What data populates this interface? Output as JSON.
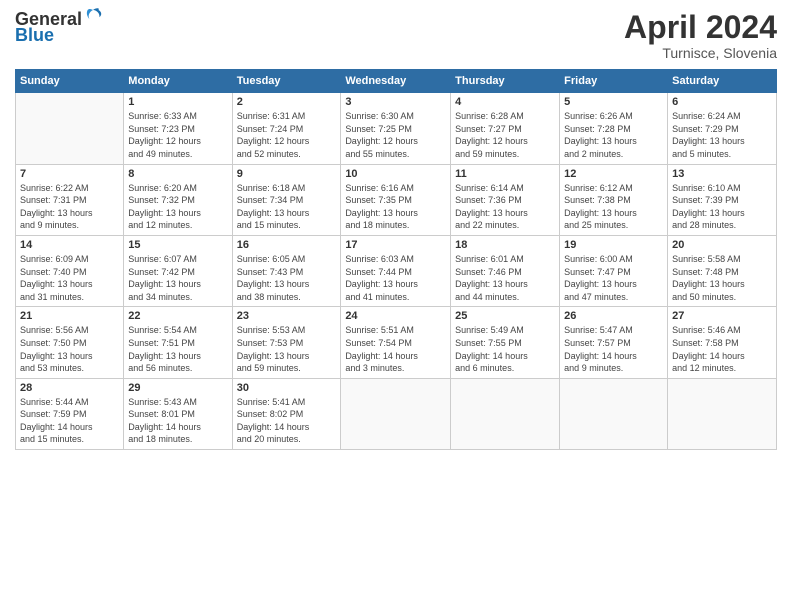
{
  "logo": {
    "text_general": "General",
    "text_blue": "Blue"
  },
  "title": "April 2024",
  "subtitle": "Turnisce, Slovenia",
  "header_days": [
    "Sunday",
    "Monday",
    "Tuesday",
    "Wednesday",
    "Thursday",
    "Friday",
    "Saturday"
  ],
  "weeks": [
    [
      {
        "day": "",
        "info": ""
      },
      {
        "day": "1",
        "info": "Sunrise: 6:33 AM\nSunset: 7:23 PM\nDaylight: 12 hours\nand 49 minutes."
      },
      {
        "day": "2",
        "info": "Sunrise: 6:31 AM\nSunset: 7:24 PM\nDaylight: 12 hours\nand 52 minutes."
      },
      {
        "day": "3",
        "info": "Sunrise: 6:30 AM\nSunset: 7:25 PM\nDaylight: 12 hours\nand 55 minutes."
      },
      {
        "day": "4",
        "info": "Sunrise: 6:28 AM\nSunset: 7:27 PM\nDaylight: 12 hours\nand 59 minutes."
      },
      {
        "day": "5",
        "info": "Sunrise: 6:26 AM\nSunset: 7:28 PM\nDaylight: 13 hours\nand 2 minutes."
      },
      {
        "day": "6",
        "info": "Sunrise: 6:24 AM\nSunset: 7:29 PM\nDaylight: 13 hours\nand 5 minutes."
      }
    ],
    [
      {
        "day": "7",
        "info": "Sunrise: 6:22 AM\nSunset: 7:31 PM\nDaylight: 13 hours\nand 9 minutes."
      },
      {
        "day": "8",
        "info": "Sunrise: 6:20 AM\nSunset: 7:32 PM\nDaylight: 13 hours\nand 12 minutes."
      },
      {
        "day": "9",
        "info": "Sunrise: 6:18 AM\nSunset: 7:34 PM\nDaylight: 13 hours\nand 15 minutes."
      },
      {
        "day": "10",
        "info": "Sunrise: 6:16 AM\nSunset: 7:35 PM\nDaylight: 13 hours\nand 18 minutes."
      },
      {
        "day": "11",
        "info": "Sunrise: 6:14 AM\nSunset: 7:36 PM\nDaylight: 13 hours\nand 22 minutes."
      },
      {
        "day": "12",
        "info": "Sunrise: 6:12 AM\nSunset: 7:38 PM\nDaylight: 13 hours\nand 25 minutes."
      },
      {
        "day": "13",
        "info": "Sunrise: 6:10 AM\nSunset: 7:39 PM\nDaylight: 13 hours\nand 28 minutes."
      }
    ],
    [
      {
        "day": "14",
        "info": "Sunrise: 6:09 AM\nSunset: 7:40 PM\nDaylight: 13 hours\nand 31 minutes."
      },
      {
        "day": "15",
        "info": "Sunrise: 6:07 AM\nSunset: 7:42 PM\nDaylight: 13 hours\nand 34 minutes."
      },
      {
        "day": "16",
        "info": "Sunrise: 6:05 AM\nSunset: 7:43 PM\nDaylight: 13 hours\nand 38 minutes."
      },
      {
        "day": "17",
        "info": "Sunrise: 6:03 AM\nSunset: 7:44 PM\nDaylight: 13 hours\nand 41 minutes."
      },
      {
        "day": "18",
        "info": "Sunrise: 6:01 AM\nSunset: 7:46 PM\nDaylight: 13 hours\nand 44 minutes."
      },
      {
        "day": "19",
        "info": "Sunrise: 6:00 AM\nSunset: 7:47 PM\nDaylight: 13 hours\nand 47 minutes."
      },
      {
        "day": "20",
        "info": "Sunrise: 5:58 AM\nSunset: 7:48 PM\nDaylight: 13 hours\nand 50 minutes."
      }
    ],
    [
      {
        "day": "21",
        "info": "Sunrise: 5:56 AM\nSunset: 7:50 PM\nDaylight: 13 hours\nand 53 minutes."
      },
      {
        "day": "22",
        "info": "Sunrise: 5:54 AM\nSunset: 7:51 PM\nDaylight: 13 hours\nand 56 minutes."
      },
      {
        "day": "23",
        "info": "Sunrise: 5:53 AM\nSunset: 7:53 PM\nDaylight: 13 hours\nand 59 minutes."
      },
      {
        "day": "24",
        "info": "Sunrise: 5:51 AM\nSunset: 7:54 PM\nDaylight: 14 hours\nand 3 minutes."
      },
      {
        "day": "25",
        "info": "Sunrise: 5:49 AM\nSunset: 7:55 PM\nDaylight: 14 hours\nand 6 minutes."
      },
      {
        "day": "26",
        "info": "Sunrise: 5:47 AM\nSunset: 7:57 PM\nDaylight: 14 hours\nand 9 minutes."
      },
      {
        "day": "27",
        "info": "Sunrise: 5:46 AM\nSunset: 7:58 PM\nDaylight: 14 hours\nand 12 minutes."
      }
    ],
    [
      {
        "day": "28",
        "info": "Sunrise: 5:44 AM\nSunset: 7:59 PM\nDaylight: 14 hours\nand 15 minutes."
      },
      {
        "day": "29",
        "info": "Sunrise: 5:43 AM\nSunset: 8:01 PM\nDaylight: 14 hours\nand 18 minutes."
      },
      {
        "day": "30",
        "info": "Sunrise: 5:41 AM\nSunset: 8:02 PM\nDaylight: 14 hours\nand 20 minutes."
      },
      {
        "day": "",
        "info": ""
      },
      {
        "day": "",
        "info": ""
      },
      {
        "day": "",
        "info": ""
      },
      {
        "day": "",
        "info": ""
      }
    ]
  ]
}
